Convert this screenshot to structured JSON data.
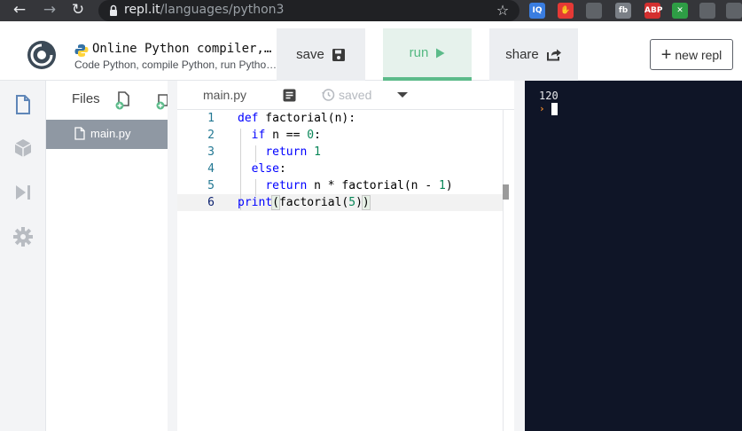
{
  "browser": {
    "url_host": "repl.it",
    "url_path": "/languages/python3",
    "extensions": [
      {
        "name": "iq-extension-icon",
        "label": "IQ",
        "color": "#3a7de0"
      },
      {
        "name": "adblocker-hand-icon",
        "label": "✋",
        "color": "#e53935"
      },
      {
        "name": "bird-extension-icon",
        "label": "",
        "color": "#5f6368"
      },
      {
        "name": "fb-extension-icon",
        "label": "fb",
        "color": "#7a7f86"
      },
      {
        "name": "abp-extension-icon",
        "label": "ABP",
        "color": "#d32f2f"
      },
      {
        "name": "green-extension-icon",
        "label": "✕",
        "color": "#2e9d45"
      },
      {
        "name": "broom-extension-icon",
        "label": "",
        "color": "#5f6368"
      },
      {
        "name": "globe-extension-icon",
        "label": "",
        "color": "#5f6368"
      }
    ]
  },
  "header": {
    "title": "Online Python compiler,…",
    "subtitle": "Code Python, compile Python, run Pytho…",
    "save_label": "save",
    "run_label": "run",
    "share_label": "share",
    "new_repl_label": "new repl"
  },
  "files": {
    "heading": "Files",
    "items": [
      {
        "name": "main.py"
      }
    ]
  },
  "editor": {
    "tab_label": "main.py",
    "saved_label": "saved",
    "line_numbers": [
      "1",
      "2",
      "3",
      "4",
      "5",
      "6"
    ]
  },
  "console": {
    "output": "120"
  },
  "colors": {
    "run_accent": "#5cbb8a",
    "console_bg": "#0f1527",
    "prompt": "#f18b2b",
    "file_selected": "#8f98a3"
  }
}
